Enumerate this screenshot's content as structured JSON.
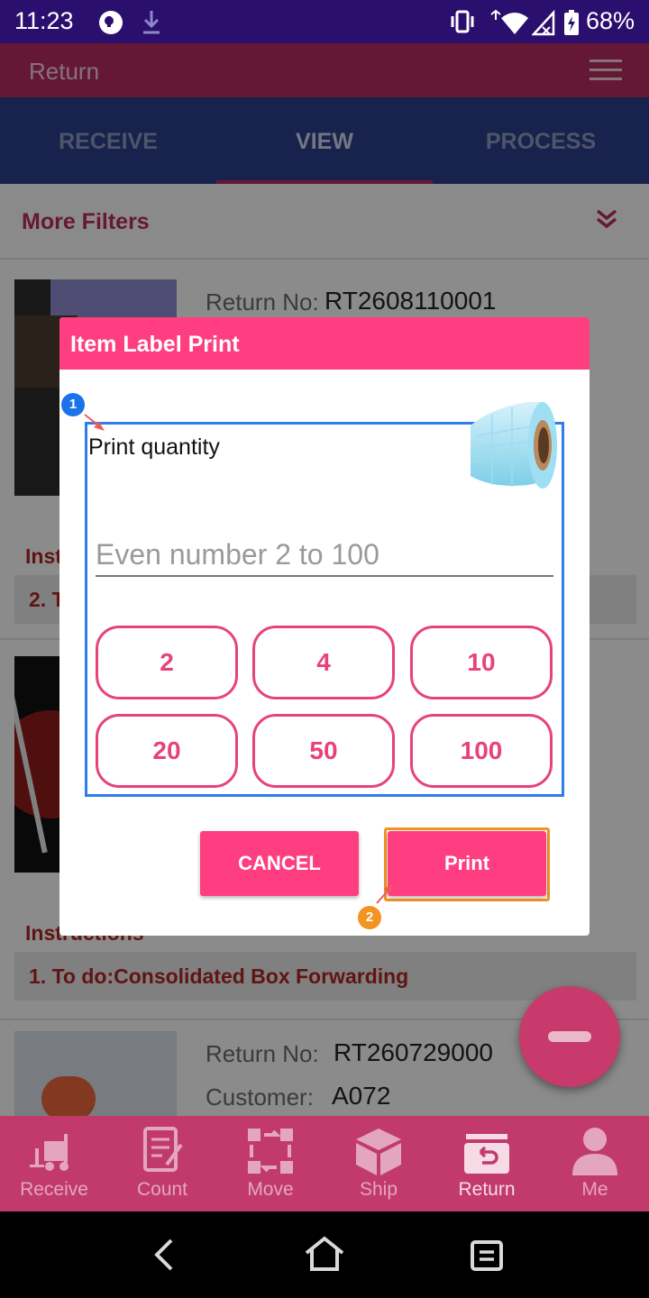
{
  "status_bar": {
    "time": "11:23",
    "battery": "68%"
  },
  "app_bar": {
    "title": "Return"
  },
  "tabs": [
    {
      "label": "RECEIVE",
      "active": false
    },
    {
      "label": "VIEW",
      "active": true
    },
    {
      "label": "PROCESS",
      "active": false
    }
  ],
  "filters": {
    "label": "More Filters"
  },
  "list": {
    "card1": {
      "return_no_label": "Return No:",
      "return_no": "RT2608110001",
      "instructions_label": "Inst",
      "todo": "2. T"
    },
    "card2": {
      "instructions_label": "Instructions",
      "todo": "1. To do:Consolidated Box Forwarding"
    },
    "card3": {
      "return_no_label": "Return No:",
      "return_no": "RT260729000",
      "customer_label": "Customer:",
      "customer": "A072"
    }
  },
  "dialog": {
    "title": "Item Label Print",
    "quantity_label": "Print quantity",
    "input_placeholder": "Even number 2 to 100",
    "quick_buttons": [
      "2",
      "4",
      "10",
      "20",
      "50",
      "100"
    ],
    "cancel_label": "CANCEL",
    "print_label": "Print",
    "markers": [
      "1",
      "2"
    ]
  },
  "bottom_nav": [
    {
      "label": "Receive",
      "icon": "forklift-icon",
      "active": false
    },
    {
      "label": "Count",
      "icon": "clipboard-icon",
      "active": false
    },
    {
      "label": "Move",
      "icon": "move-arrows-icon",
      "active": false
    },
    {
      "label": "Ship",
      "icon": "box-icon",
      "active": false
    },
    {
      "label": "Return",
      "icon": "return-tray-icon",
      "active": true
    },
    {
      "label": "Me",
      "icon": "person-icon",
      "active": false
    }
  ],
  "colors": {
    "primary": "#fe3e80",
    "tab_bar": "#2a3d86",
    "header": "#ad2a5a",
    "highlight_blue": "#2f7de8",
    "highlight_orange": "#f39321"
  }
}
